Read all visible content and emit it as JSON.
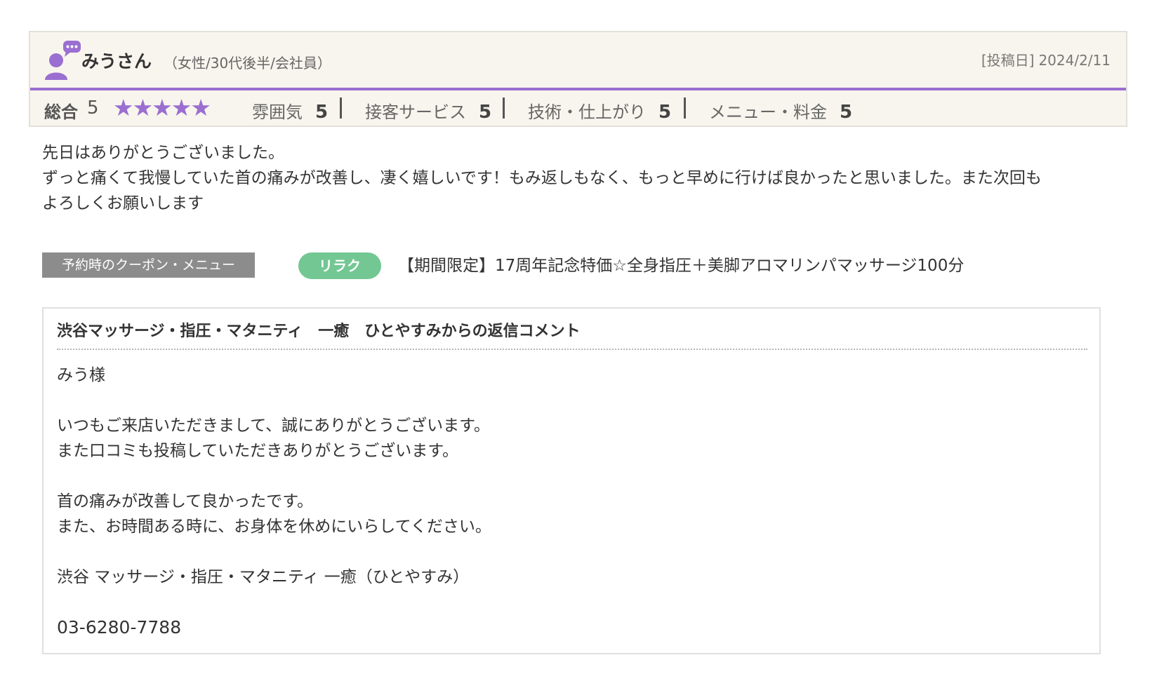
{
  "review": {
    "user_name": "みうさん",
    "user_profile": "（女性/30代後半/会社員）",
    "post_date_label": "[投稿日]",
    "post_date": "2024/2/11",
    "overall_label": "総合",
    "overall_score": "5",
    "star_rating": 5,
    "stars": "★★★★★",
    "sub_ratings": [
      {
        "label": "雰囲気",
        "score": "5"
      },
      {
        "label": "接客サービス",
        "score": "5"
      },
      {
        "label": "技術・仕上がり",
        "score": "5"
      },
      {
        "label": "メニュー・料金",
        "score": "5"
      }
    ],
    "body_lines": [
      "先日はありがとうございました。",
      "ずっと痛くて我慢していた首の痛みが改善し、凄く嬉しいです！もみ返しもなく、もっと早めに行けば良かったと思いました。また次回も",
      "よろしくお願いします"
    ],
    "accent_color": "#9b6fd1"
  },
  "coupon": {
    "label": "予約時のクーポン・メニュー",
    "category": "リラク",
    "category_color": "#73c793",
    "name": "【期間限定】17周年記念特価☆全身指圧＋美脚アロマリンパマッサージ100分"
  },
  "reply": {
    "title": "渋谷マッサージ・指圧・マタニティ　一癒　ひとやすみからの返信コメント",
    "lines": [
      "みう様",
      "",
      "いつもご来店いただきまして、誠にありがとうございます。",
      "また口コミも投稿していただきありがとうございます。",
      "",
      "首の痛みが改善して良かったです。",
      "また、お時間ある時に、お身体を休めにいらしてください。",
      "",
      "渋谷 マッサージ・指圧・マタニティ 一癒（ひとやすみ）",
      "",
      "03-6280-7788"
    ]
  }
}
